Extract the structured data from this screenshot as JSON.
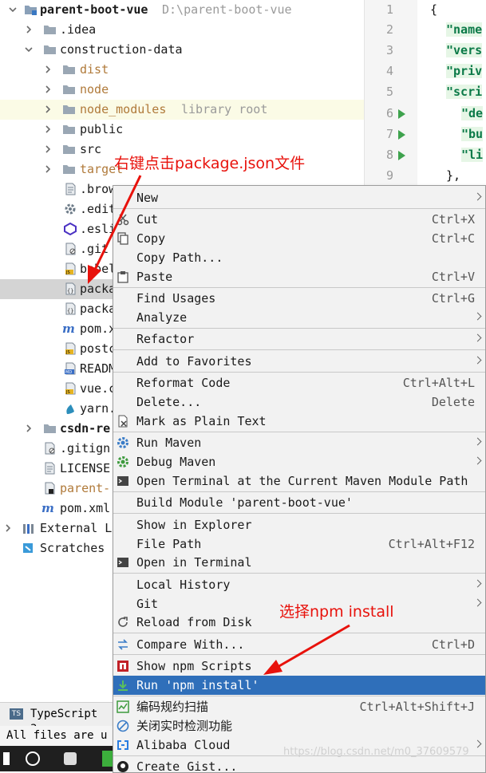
{
  "project_tree": {
    "root": {
      "label": "parent-boot-vue",
      "path": "D:\\parent-boot-vue"
    },
    "items": [
      {
        "label": ".idea"
      },
      {
        "label": "construction-data"
      },
      {
        "label": "dist"
      },
      {
        "label": "node"
      },
      {
        "label": "node_modules",
        "hint": "library root"
      },
      {
        "label": "public"
      },
      {
        "label": "src"
      },
      {
        "label": "target"
      },
      {
        "label": ".brow"
      },
      {
        "label": ".edit"
      },
      {
        "label": ".esli"
      },
      {
        "label": ".git"
      },
      {
        "label": "babel"
      },
      {
        "label": "packa"
      },
      {
        "label": "packa"
      },
      {
        "label": "pom.x"
      },
      {
        "label": "postc"
      },
      {
        "label": "READM"
      },
      {
        "label": "vue.c"
      },
      {
        "label": "yarn."
      },
      {
        "label": "csdn-re"
      },
      {
        "label": ".gitign"
      },
      {
        "label": "LICENSE"
      },
      {
        "label": "parent-"
      },
      {
        "label": "pom.xml"
      },
      {
        "label": "External L"
      },
      {
        "label": "Scratches"
      }
    ]
  },
  "editor": {
    "line_numbers": [
      "1",
      "2",
      "3",
      "4",
      "5",
      "6",
      "7",
      "8",
      "9"
    ],
    "lines": [
      "{",
      "\"name",
      "\"vers",
      "\"priv",
      "\"scri",
      "\"de",
      "\"bu",
      "\"li",
      "},"
    ]
  },
  "context_menu": {
    "items": [
      {
        "label": "New",
        "shortcut": ""
      },
      {
        "label": "Cut",
        "shortcut": "Ctrl+X"
      },
      {
        "label": "Copy",
        "shortcut": "Ctrl+C"
      },
      {
        "label": "Copy Path...",
        "shortcut": ""
      },
      {
        "label": "Paste",
        "shortcut": "Ctrl+V"
      },
      {
        "label": "Find Usages",
        "shortcut": "Ctrl+G"
      },
      {
        "label": "Analyze",
        "shortcut": ""
      },
      {
        "label": "Refactor",
        "shortcut": ""
      },
      {
        "label": "Add to Favorites",
        "shortcut": ""
      },
      {
        "label": "Reformat Code",
        "shortcut": "Ctrl+Alt+L"
      },
      {
        "label": "Delete...",
        "shortcut": "Delete"
      },
      {
        "label": "Mark as Plain Text",
        "shortcut": ""
      },
      {
        "label": "Run Maven",
        "shortcut": ""
      },
      {
        "label": "Debug Maven",
        "shortcut": ""
      },
      {
        "label": "Open Terminal at the Current Maven Module Path",
        "shortcut": ""
      },
      {
        "label": "Build Module 'parent-boot-vue'",
        "shortcut": ""
      },
      {
        "label": "Show in Explorer",
        "shortcut": ""
      },
      {
        "label": "File Path",
        "shortcut": "Ctrl+Alt+F12"
      },
      {
        "label": "Open in Terminal",
        "shortcut": ""
      },
      {
        "label": "Local History",
        "shortcut": ""
      },
      {
        "label": "Git",
        "shortcut": ""
      },
      {
        "label": "Reload from Disk",
        "shortcut": ""
      },
      {
        "label": "Compare With...",
        "shortcut": "Ctrl+D"
      },
      {
        "label": "Show npm Scripts",
        "shortcut": ""
      },
      {
        "label": "Run 'npm install'",
        "shortcut": ""
      },
      {
        "label": "编码规约扫描",
        "shortcut": "Ctrl+Alt+Shift+J"
      },
      {
        "label": "关闭实时检测功能",
        "shortcut": ""
      },
      {
        "label": "Alibaba Cloud",
        "shortcut": ""
      },
      {
        "label": "Create Gist...",
        "shortcut": ""
      }
    ]
  },
  "bottom": {
    "tab_label": "TypeScript 3.",
    "status_text": "All files are u"
  },
  "annotations": {
    "right_click_note": "右键点击package.json文件",
    "select_note": "选择npm install"
  },
  "watermark": "https://blog.csdn.net/m0_37609579",
  "colors": {
    "selection": "#2f6fba",
    "annotation": "#e8120c",
    "json_key": "#0b7a48"
  }
}
